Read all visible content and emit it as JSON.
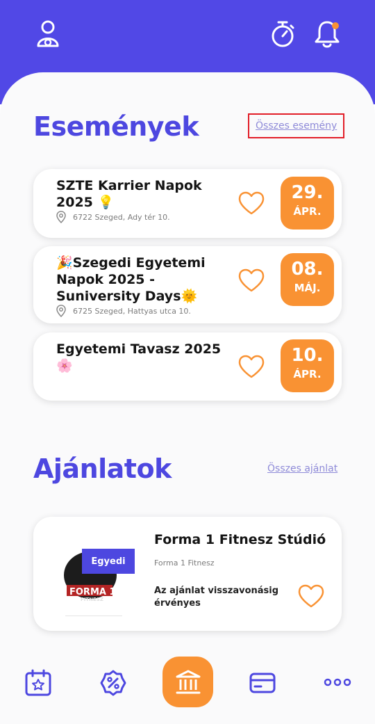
{
  "header": {
    "icons": [
      "profile-icon",
      "stopwatch-icon",
      "bell-icon"
    ],
    "notification_dot_color": "#f99233"
  },
  "events": {
    "title": "Események",
    "see_all": "Összes esemény",
    "items": [
      {
        "title": "SZTE Karrier Napok 2025 💡",
        "location": "6722 Szeged, Ady tér 10.",
        "day": "29.",
        "month": "ÁPR."
      },
      {
        "title": "🎉Szegedi Egyetemi Napok 2025 - Suniversity Days🌞",
        "location": "6725 Szeged, Hattyas utca 10.",
        "day": "08.",
        "month": "MÁJ."
      },
      {
        "title": "Egyetemi Tavasz 2025 🌸",
        "location": "",
        "day": "10.",
        "month": "ÁPR."
      }
    ]
  },
  "offers": {
    "title": "Ajánlatok",
    "see_all": "Összes ajánlat",
    "items": [
      {
        "badge": "Egyedi",
        "title": "Forma 1 Fitnesz Stúdió",
        "subtitle": "Forma 1 Fitnesz",
        "validity": "Az ajánlat visszavonásig érvényes",
        "logo_text": "FORMA 1",
        "logo_sub": "FITNESZ"
      }
    ]
  },
  "bottom_nav": {
    "items": [
      "calendar-star-icon",
      "discount-icon",
      "institution-icon",
      "card-icon",
      "more-icon"
    ]
  },
  "colors": {
    "primary": "#4d47e0",
    "accent": "#f99233",
    "highlight": "#e21d27"
  }
}
